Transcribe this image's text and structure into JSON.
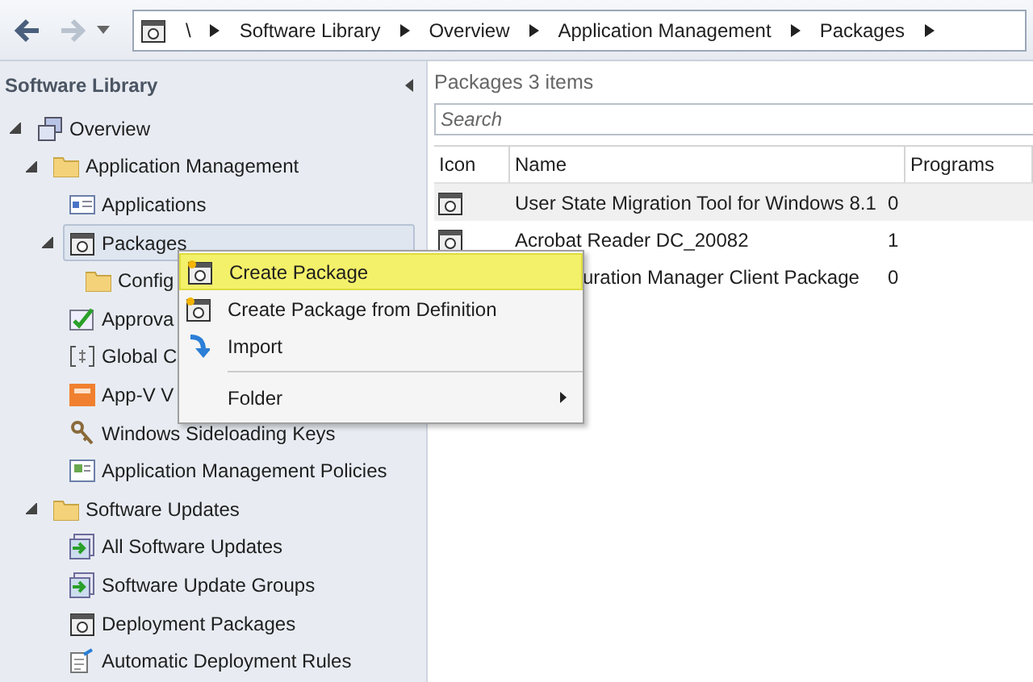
{
  "toolbar": {
    "breadcrumb": [
      "\\",
      "Software Library",
      "Overview",
      "Application Management",
      "Packages"
    ]
  },
  "sidebar": {
    "title": "Software Library",
    "tree": [
      {
        "label": "Overview",
        "kind": "overview",
        "expanded": true,
        "selected": false,
        "children": [
          {
            "label": "Application Management",
            "kind": "folder",
            "expanded": true,
            "selected": false,
            "children": [
              {
                "label": "Applications",
                "kind": "applications",
                "selected": false
              },
              {
                "label": "Packages",
                "kind": "package",
                "expanded": true,
                "selected": true,
                "children": [
                  {
                    "label": "Config",
                    "kind": "folder",
                    "selected": false
                  }
                ]
              },
              {
                "label": "Approva",
                "kind": "approval",
                "selected": false
              },
              {
                "label": "Global C",
                "kind": "global",
                "selected": false
              },
              {
                "label": "App-V V",
                "kind": "appv",
                "selected": false
              },
              {
                "label": "Windows Sideloading Keys",
                "kind": "keys",
                "selected": false
              },
              {
                "label": "Application Management Policies",
                "kind": "policies",
                "selected": false
              }
            ]
          },
          {
            "label": "Software Updates",
            "kind": "folder",
            "expanded": true,
            "selected": false,
            "children": [
              {
                "label": "All Software Updates",
                "kind": "updates",
                "selected": false
              },
              {
                "label": "Software Update Groups",
                "kind": "updates",
                "selected": false
              },
              {
                "label": "Deployment Packages",
                "kind": "package",
                "selected": false
              },
              {
                "label": "Automatic Deployment Rules",
                "kind": "rules",
                "selected": false
              }
            ]
          }
        ]
      }
    ]
  },
  "content": {
    "title": "Packages 3 items",
    "search": {
      "placeholder": "Search"
    },
    "table": {
      "columns": [
        "Icon",
        "Name",
        "Programs"
      ],
      "rows": [
        {
          "name": "User State Migration Tool for Windows 8.1",
          "programs": "0",
          "selected": true
        },
        {
          "name": "Acrobat Reader DC_20082",
          "programs": "1",
          "selected": false
        },
        {
          "name": "uration Manager Client Package",
          "programs": "0",
          "selected": false
        }
      ]
    }
  },
  "context_menu": {
    "items": [
      {
        "label": "Create Package",
        "kind": "command",
        "selected": true
      },
      {
        "label": "Create Package from Definition",
        "kind": "command",
        "selected": false
      },
      {
        "label": "Import",
        "kind": "command",
        "selected": false
      },
      {
        "kind": "separator"
      },
      {
        "label": "Folder",
        "kind": "submenu",
        "selected": false
      }
    ]
  }
}
